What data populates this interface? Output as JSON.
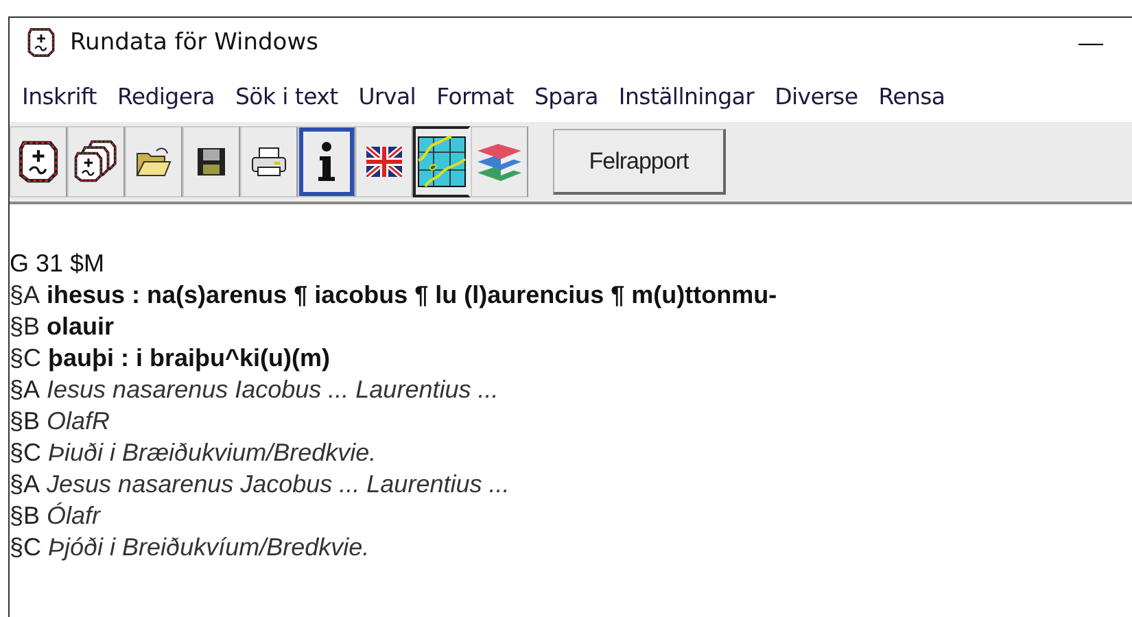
{
  "window": {
    "title": "Rundata för Windows",
    "minimize": "—"
  },
  "menu": [
    "Inskrift",
    "Redigera",
    "Sök i text",
    "Urval",
    "Format",
    "Spara",
    "Inställningar",
    "Diverse",
    "Rensa"
  ],
  "toolbar": {
    "tools": [
      {
        "kind": "new",
        "pressed": false,
        "focused": false
      },
      {
        "kind": "multi",
        "pressed": false,
        "focused": false
      },
      {
        "kind": "open",
        "pressed": false,
        "focused": false
      },
      {
        "kind": "save",
        "pressed": false,
        "focused": false
      },
      {
        "kind": "print",
        "pressed": false,
        "focused": false
      },
      {
        "kind": "info",
        "pressed": false,
        "focused": true
      },
      {
        "kind": "flag",
        "pressed": false,
        "focused": false
      },
      {
        "kind": "map",
        "pressed": true,
        "focused": false
      },
      {
        "kind": "books",
        "pressed": false,
        "focused": false
      }
    ],
    "button": "Felrapport"
  },
  "lines": [
    {
      "label": "G 31 $M",
      "kind": "header"
    },
    {
      "label": "§A",
      "text": "ihesus : na(s)arenus ¶ iacobus ¶ lu (l)aurencius ¶ m(u)ttonmu-",
      "kind": "transliteration"
    },
    {
      "label": "§B",
      "text": "olauir",
      "kind": "transliteration"
    },
    {
      "label": "§C",
      "text": "þauþi : i braiþu^ki(u)(m)",
      "kind": "transliteration"
    },
    {
      "label": "§A",
      "text": "Iesus nasarenus Iacobus ... Laurentius ...",
      "kind": "normalization"
    },
    {
      "label": "§B",
      "text": "OlafR",
      "kind": "normalization"
    },
    {
      "label": "§C",
      "text": "Þiuði i Bræiðukvium/Bredkvie.",
      "kind": "normalization"
    },
    {
      "label": "§A",
      "text": "Jesus nasarenus Jacobus ... Laurentius ...",
      "kind": "normalization"
    },
    {
      "label": "§B",
      "text": "Ólafr",
      "kind": "normalization"
    },
    {
      "label": "§C",
      "text": "Þjóði i Breiðukvíum/Bredkvie.",
      "kind": "normalization"
    }
  ]
}
